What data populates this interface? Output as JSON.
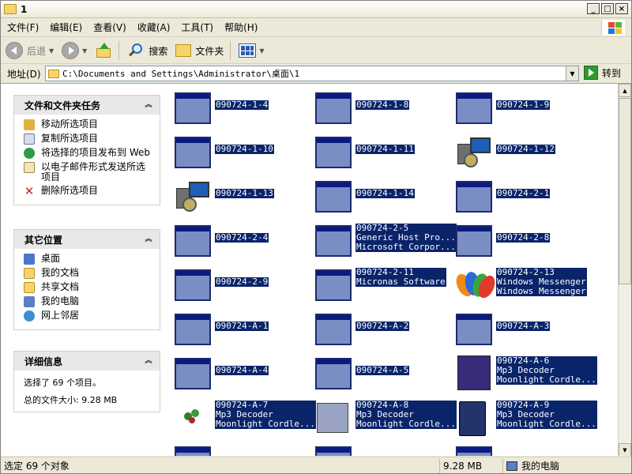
{
  "window": {
    "title": "1"
  },
  "window_buttons": {
    "minimize": "_",
    "maximize": "□",
    "close": "×"
  },
  "menu": [
    "文件(F)",
    "编辑(E)",
    "查看(V)",
    "收藏(A)",
    "工具(T)",
    "帮助(H)"
  ],
  "toolbar": {
    "back": "后退",
    "search": "搜索",
    "folders": "文件夹"
  },
  "address": {
    "label": "地址(D)",
    "value": "C:\\Documents and Settings\\Administrator\\桌面\\1",
    "go": "转到"
  },
  "tasks_panel": {
    "title": "文件和文件夹任务",
    "items": [
      "移动所选项目",
      "复制所选项目",
      "将选择的项目发布到 Web",
      "以电子邮件形式发送所选项目",
      "删除所选项目"
    ]
  },
  "places_panel": {
    "title": "其它位置",
    "items": [
      "桌面",
      "我的文档",
      "共享文档",
      "我的电脑",
      "网上邻居"
    ]
  },
  "details_panel": {
    "title": "详细信息",
    "line1": "选择了 69 个项目。",
    "line2": "总的文件大小: 9.28 MB"
  },
  "files": [
    {
      "name": "090724-1-4",
      "icon": "app-window"
    },
    {
      "name": "090724-1-8",
      "icon": "app-window"
    },
    {
      "name": "090724-1-9",
      "icon": "app-window"
    },
    {
      "name": "090724-1-10",
      "icon": "app-window"
    },
    {
      "name": "090724-1-11",
      "icon": "app-window"
    },
    {
      "name": "090724-1-12",
      "icon": "setup"
    },
    {
      "name": "090724-1-13",
      "icon": "setup"
    },
    {
      "name": "090724-1-14",
      "icon": "app-window"
    },
    {
      "name": "090724-2-1",
      "icon": "app-window"
    },
    {
      "name": "090724-2-4",
      "icon": "app-window"
    },
    {
      "name": "090724-2-5",
      "icon": "app-window",
      "line2": "Generic Host Pro...",
      "line3": "Microsoft Corpor..."
    },
    {
      "name": "090724-2-8",
      "icon": "app-window"
    },
    {
      "name": "090724-2-9",
      "icon": "app-window"
    },
    {
      "name": "090724-2-11",
      "icon": "app-window",
      "line2": "Micronas Software"
    },
    {
      "name": "090724-2-13",
      "icon": "messenger",
      "line2": "Windows Messenger",
      "line3": "Windows Messenger"
    },
    {
      "name": "090724-A-1",
      "icon": "app-window"
    },
    {
      "name": "090724-A-2",
      "icon": "app-window"
    },
    {
      "name": "090724-A-3",
      "icon": "app-window"
    },
    {
      "name": "090724-A-4",
      "icon": "app-window"
    },
    {
      "name": "090724-A-5",
      "icon": "app-window"
    },
    {
      "name": "090724-A-6",
      "icon": "mp3-art",
      "line2": "Mp3 Decoder",
      "line3": "Moonlight Cordle..."
    },
    {
      "name": "090724-A-7",
      "icon": "ivy",
      "line2": "Mp3 Decoder",
      "line3": "Moonlight Cordle..."
    },
    {
      "name": "090724-A-8",
      "icon": "box",
      "line2": "Mp3 Decoder",
      "line3": "Moonlight Cordle..."
    },
    {
      "name": "090724-A-9",
      "icon": "book",
      "line2": "Mp3 Decoder",
      "line3": "Moonlight Cordle..."
    }
  ],
  "status": {
    "left": "选定 69 个对象",
    "size": "9.28 MB",
    "location": "我的电脑"
  },
  "colors": {
    "selection": "#0a246a",
    "chrome": "#ece9d8",
    "app_icon": "#7b8ec4"
  }
}
